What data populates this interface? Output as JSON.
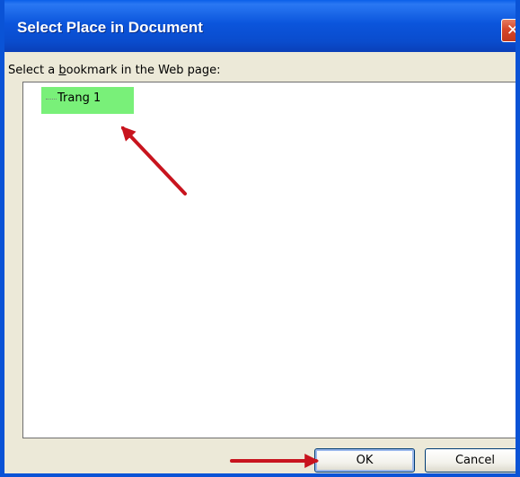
{
  "dialog": {
    "title": "Select Place in Document",
    "close_glyph": "✕"
  },
  "label": {
    "before": "Select a ",
    "accel": "b",
    "after": "ookmark in the Web page:"
  },
  "tree": {
    "items": [
      {
        "label": "Trang 1",
        "selected": true,
        "highlight_color": "#79f079"
      }
    ]
  },
  "buttons": {
    "ok_label": "OK",
    "cancel_label": "Cancel"
  },
  "colors": {
    "title_bar": "#0a4ccd",
    "dialog_face": "#ece9d8",
    "annotation_arrow": "#c8141e"
  }
}
